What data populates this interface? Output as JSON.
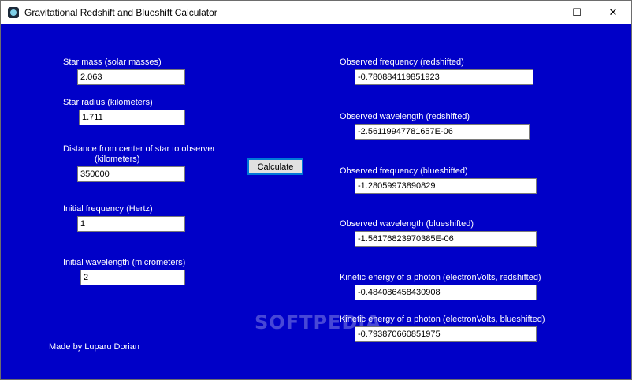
{
  "window": {
    "title": "Gravitational Redshift and Blueshift Calculator",
    "controls": {
      "minimize": "—",
      "maximize": "☐",
      "close": "✕"
    }
  },
  "inputs": {
    "star_mass": {
      "label": "Star mass (solar masses)",
      "value": "2.063"
    },
    "star_radius": {
      "label": "Star radius (kilometers)",
      "value": "1.711"
    },
    "distance": {
      "label_line1": "Distance from center of star to observer",
      "label_line2": "(kilometers)",
      "value": "350000"
    },
    "initial_frequency": {
      "label": "Initial frequency (Hertz)",
      "value": "1"
    },
    "initial_wavelength": {
      "label": "Initial wavelength (micrometers)",
      "value": "2"
    }
  },
  "calculate_label": "Calculate",
  "outputs": {
    "freq_red": {
      "label": "Observed frequency (redshifted)",
      "value": "-0.780884119851923"
    },
    "wave_red": {
      "label": "Observed wavelength (redshifted)",
      "value": "-2.56119947781657E-06"
    },
    "freq_blue": {
      "label": "Observed frequency (blueshifted)",
      "value": "-1.28059973890829"
    },
    "wave_blue": {
      "label": "Observed wavelength (blueshifted)",
      "value": "-1.56176823970385E-06"
    },
    "ke_red": {
      "label": "Kinetic energy of a photon (electronVolts, redshifted)",
      "value": "-0.484086458430908"
    },
    "ke_blue": {
      "label": "Kinetic energy of a photon (electronVolts, blueshifted)",
      "value": "-0.793870660851975"
    }
  },
  "credit": "Made by Luparu Dorian",
  "watermark": "SOFTPEDIA",
  "colors": {
    "background": "#0000c8",
    "text": "#ffffff",
    "button_border": "#0078d7"
  }
}
